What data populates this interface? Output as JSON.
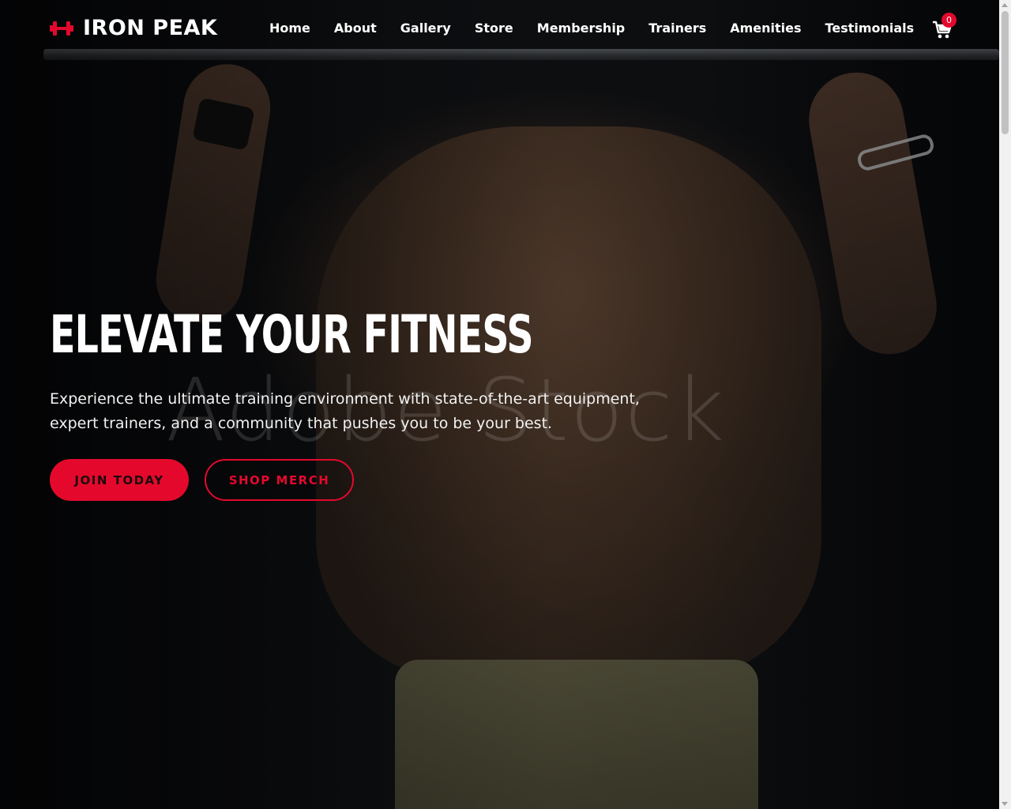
{
  "brand": {
    "name": "IRON PEAK",
    "icon": "dumbbell-icon",
    "accent": "#e4092c"
  },
  "nav": {
    "items": [
      {
        "label": "Home"
      },
      {
        "label": "About"
      },
      {
        "label": "Gallery"
      },
      {
        "label": "Store"
      },
      {
        "label": "Membership"
      },
      {
        "label": "Trainers"
      },
      {
        "label": "Amenities"
      },
      {
        "label": "Testimonials"
      }
    ]
  },
  "cart": {
    "icon": "cart-icon",
    "count": "0"
  },
  "hero": {
    "title": "ELEVATE YOUR FITNESS",
    "text": "Experience the ultimate training environment with state-of-the-art equipment, expert trainers, and a community that pushes you to be your best.",
    "watermark": "Adobe Stock",
    "primary_button": "JOIN TODAY",
    "secondary_button": "SHOP MERCH"
  }
}
